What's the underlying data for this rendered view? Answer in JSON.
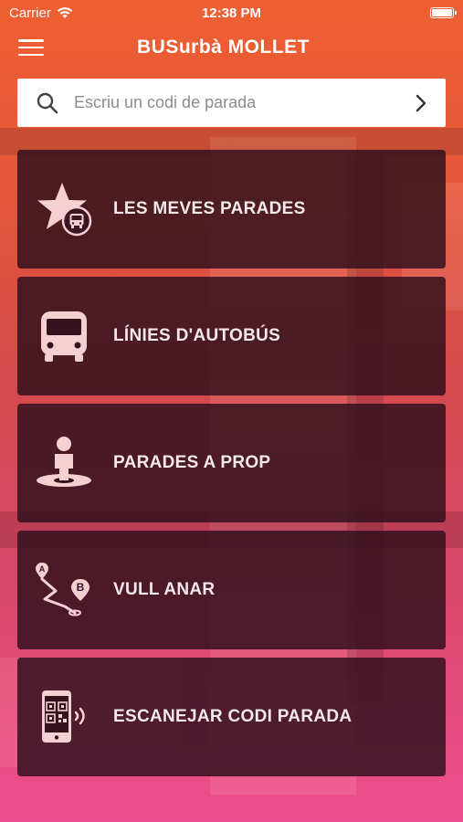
{
  "status_bar": {
    "carrier": "Carrier",
    "time": "12:38 PM"
  },
  "header": {
    "title": "BUSurbà MOLLET"
  },
  "search": {
    "placeholder": "Escriu un codi de parada",
    "value": ""
  },
  "menu": [
    {
      "label": "LES MEVES PARADES",
      "icon": "star-bus-icon"
    },
    {
      "label": "LÍNIES D'AUTOBÚS",
      "icon": "bus-icon"
    },
    {
      "label": "PARADES A PROP",
      "icon": "person-location-icon"
    },
    {
      "label": "VULL ANAR",
      "icon": "route-a-to-b-icon",
      "markers": [
        "A",
        "B"
      ]
    },
    {
      "label": "ESCANEJAR CODI PARADA",
      "icon": "qr-phone-icon"
    }
  ],
  "colors": {
    "gradient_top": "#ee5f32",
    "gradient_bottom": "#ee4f8e",
    "card_bg": "#34121e",
    "icon_fill": "#f4d0d3",
    "label": "#f3e8ea"
  }
}
